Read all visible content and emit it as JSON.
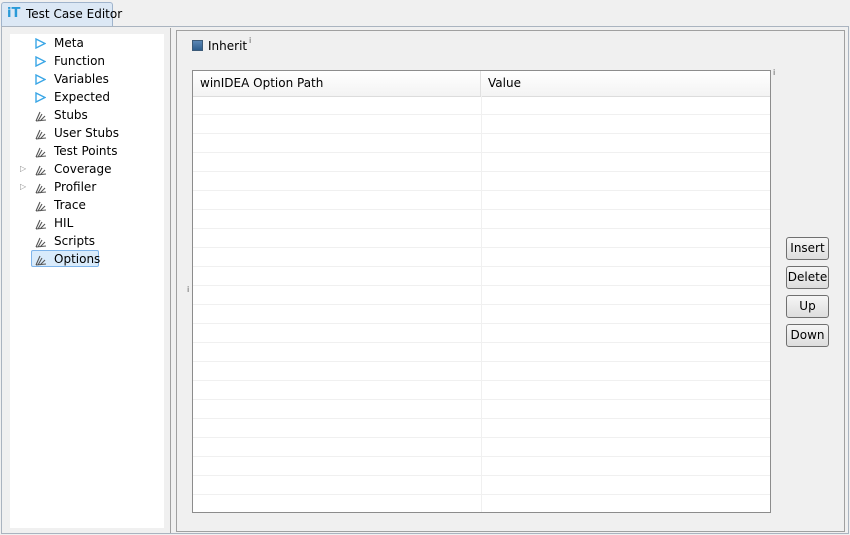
{
  "tab": {
    "icon": "iT",
    "label": "Test Case Editor"
  },
  "tree": {
    "items": [
      {
        "label": "Meta",
        "icon": "play-arrow-icon",
        "expandable": false,
        "selected": false
      },
      {
        "label": "Function",
        "icon": "play-arrow-icon",
        "expandable": false,
        "selected": false
      },
      {
        "label": "Variables",
        "icon": "play-arrow-icon",
        "expandable": false,
        "selected": false
      },
      {
        "label": "Expected",
        "icon": "play-arrow-icon",
        "expandable": false,
        "selected": false
      },
      {
        "label": "Stubs",
        "icon": "tool-icon",
        "expandable": false,
        "selected": false
      },
      {
        "label": "User Stubs",
        "icon": "tool-icon",
        "expandable": false,
        "selected": false
      },
      {
        "label": "Test Points",
        "icon": "tool-icon",
        "expandable": false,
        "selected": false
      },
      {
        "label": "Coverage",
        "icon": "tool-icon",
        "expandable": true,
        "selected": false
      },
      {
        "label": "Profiler",
        "icon": "tool-icon",
        "expandable": true,
        "selected": false
      },
      {
        "label": "Trace",
        "icon": "tool-icon",
        "expandable": false,
        "selected": false
      },
      {
        "label": "HIL",
        "icon": "tool-icon",
        "expandable": false,
        "selected": false
      },
      {
        "label": "Scripts",
        "icon": "tool-icon",
        "expandable": false,
        "selected": false
      },
      {
        "label": "Options",
        "icon": "tool-icon",
        "expandable": false,
        "selected": true
      }
    ]
  },
  "inherit": {
    "label": "Inherit",
    "checked": true,
    "info": "i"
  },
  "table": {
    "columns": [
      "winIDEA Option Path",
      "Value"
    ],
    "info": "i",
    "rows": []
  },
  "buttons": {
    "insert": "Insert",
    "delete": "Delete",
    "up": "Up",
    "down": "Down"
  },
  "side_info": "i",
  "colors": {
    "accent": "#3aa6e6",
    "selection": "#d9ebfb",
    "selection_border": "#7eb4ea"
  }
}
